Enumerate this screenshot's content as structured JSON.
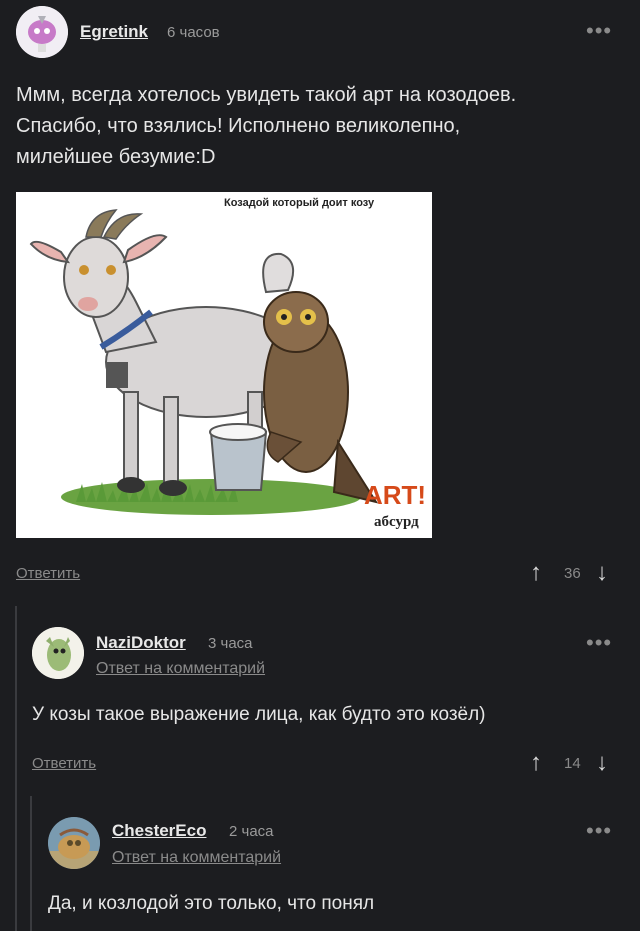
{
  "comments": [
    {
      "author": "Egretink",
      "time": "6 часов",
      "text_lines": [
        "Ммм, всегда хотелось увидеть такой арт на козодоев.",
        "Спасибо, что взялись! Исполнено великолепно,",
        "милейшее безумие:D"
      ],
      "image": {
        "caption": "Козадой который доит козу",
        "watermark_top": "ART!",
        "watermark_bottom": "абсурд"
      },
      "reply_label": "Ответить",
      "votes": "36"
    },
    {
      "author": "NaziDoktor",
      "time": "3 часа",
      "reply_to": "Ответ на комментарий",
      "text": "У козы такое выражение лица, как будто это козёл)",
      "reply_label": "Ответить",
      "votes": "14"
    },
    {
      "author": "ChesterEco",
      "time": "2 часа",
      "reply_to": "Ответ на комментарий",
      "text": "Да, и козлодой это только, что понял"
    }
  ],
  "icons": {
    "more": "more-icon",
    "upvote": "arrow-up-icon",
    "downvote": "arrow-down-icon"
  },
  "more_glyph": "•••",
  "up_glyph": "↑",
  "down_glyph": "↓"
}
